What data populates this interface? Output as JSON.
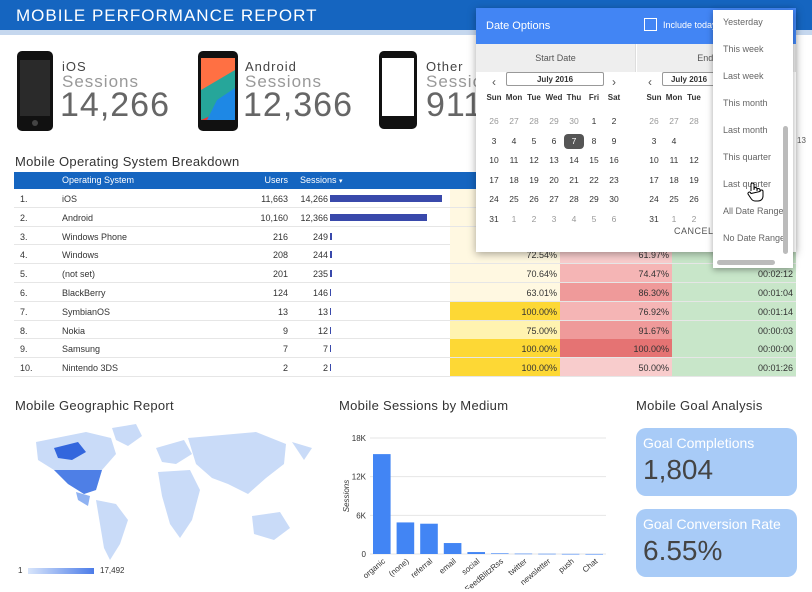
{
  "header": {
    "title": "MOBILE PERFORMANCE REPORT"
  },
  "devices": [
    {
      "name": "iOS",
      "sessions_label": "Sessions",
      "value": "14,266"
    },
    {
      "name": "Android",
      "sessions_label": "Sessions",
      "value": "12,366"
    },
    {
      "name": "Other",
      "sessions_label": "Sessions",
      "value": "911"
    }
  ],
  "breakdown": {
    "title": "Mobile Operating System Breakdown",
    "columns": {
      "os": "Operating System",
      "users": "Users",
      "sessions": "Sessions",
      "sort_icon": "sort-desc-icon"
    },
    "rows": [
      {
        "num": "1.",
        "os": "iOS",
        "users": "11,663",
        "sessions": "14,266",
        "bar": 14266,
        "c1": "",
        "c2": "",
        "c3": ""
      },
      {
        "num": "2.",
        "os": "Android",
        "users": "10,160",
        "sessions": "12,366",
        "bar": 12366,
        "c1": "",
        "c2": "",
        "c3": ""
      },
      {
        "num": "3.",
        "os": "Windows Phone",
        "users": "216",
        "sessions": "249",
        "bar": 249,
        "c1": "",
        "c2": "",
        "c3": ""
      },
      {
        "num": "4.",
        "os": "Windows",
        "users": "208",
        "sessions": "244",
        "bar": 244,
        "c1": "72.54%",
        "c2": "61.97%",
        "c3": ""
      },
      {
        "num": "5.",
        "os": "(not set)",
        "users": "201",
        "sessions": "235",
        "bar": 235,
        "c1": "70.64%",
        "c2": "74.47%",
        "c3": "00:02:12"
      },
      {
        "num": "6.",
        "os": "BlackBerry",
        "users": "124",
        "sessions": "146",
        "bar": 146,
        "c1": "63.01%",
        "c2": "86.30%",
        "c3": "00:01:04"
      },
      {
        "num": "7.",
        "os": "SymbianOS",
        "users": "13",
        "sessions": "13",
        "bar": 13,
        "c1": "100.00%",
        "c2": "76.92%",
        "c3": "00:01:14"
      },
      {
        "num": "8.",
        "os": "Nokia",
        "users": "9",
        "sessions": "12",
        "bar": 12,
        "c1": "75.00%",
        "c2": "91.67%",
        "c3": "00:00:03"
      },
      {
        "num": "9.",
        "os": "Samsung",
        "users": "7",
        "sessions": "7",
        "bar": 7,
        "c1": "100.00%",
        "c2": "100.00%",
        "c3": "00:00:00"
      },
      {
        "num": "10.",
        "os": "Nintendo 3DS",
        "users": "2",
        "sessions": "2",
        "bar": 2,
        "c1": "100.00%",
        "c2": "50.00%",
        "c3": "00:01:26"
      }
    ]
  },
  "date_options": {
    "title": "Date Options",
    "include_today": "Include today",
    "start_label": "Start Date",
    "end_label": "End Date",
    "month": "July 2016",
    "dow": [
      "Sun",
      "Mon",
      "Tue",
      "Wed",
      "Thu",
      "Fri",
      "Sat"
    ],
    "end_dow": [
      "Sun",
      "Mon",
      "Tue"
    ],
    "weeks": [
      [
        "26",
        "27",
        "28",
        "29",
        "30",
        "1",
        "2"
      ],
      [
        "3",
        "4",
        "5",
        "6",
        "7",
        "8",
        "9"
      ],
      [
        "10",
        "11",
        "12",
        "13",
        "14",
        "15",
        "16"
      ],
      [
        "17",
        "18",
        "19",
        "20",
        "21",
        "22",
        "23"
      ],
      [
        "24",
        "25",
        "26",
        "27",
        "28",
        "29",
        "30"
      ],
      [
        "31",
        "1",
        "2",
        "3",
        "4",
        "5",
        "6"
      ]
    ],
    "end_weeks": [
      [
        "26",
        "27",
        "28"
      ],
      [
        "3",
        "4",
        ""
      ],
      [
        "10",
        "11",
        "12"
      ],
      [
        "17",
        "18",
        "19"
      ],
      [
        "24",
        "25",
        "26"
      ],
      [
        "31",
        "1",
        "2"
      ]
    ],
    "selected": "7",
    "cancel": "CANCEL",
    "presets": [
      "Yesterday",
      "This week",
      "Last week",
      "This month",
      "Last month",
      "This quarter",
      "Last quarter",
      "All Date Range",
      "No Date Range"
    ],
    "edge_text": "13"
  },
  "geo": {
    "title": "Mobile Geographic Report",
    "legend_min": "1",
    "legend_max": "17,492"
  },
  "medium": {
    "title": "Mobile Sessions by Medium"
  },
  "goals": {
    "title": "Mobile Goal Analysis",
    "completions_label": "Goal Completions",
    "completions_value": "1,804",
    "conversion_label": "Goal Conversion Rate",
    "conversion_value": "6.55%"
  },
  "chart_data": {
    "type": "bar",
    "categories": [
      "organic",
      "(none)",
      "referral",
      "email",
      "social",
      "FeedBlitzRss",
      "twitter",
      "newsletter",
      "push",
      "Chat"
    ],
    "values": [
      15500,
      4900,
      4700,
      1700,
      300,
      100,
      60,
      40,
      20,
      10
    ],
    "xlabel": "",
    "ylabel": "Sessions",
    "yticks": [
      "0",
      "6K",
      "12K",
      "18K"
    ],
    "ylim": [
      0,
      18000
    ],
    "color": "#4285f4"
  }
}
